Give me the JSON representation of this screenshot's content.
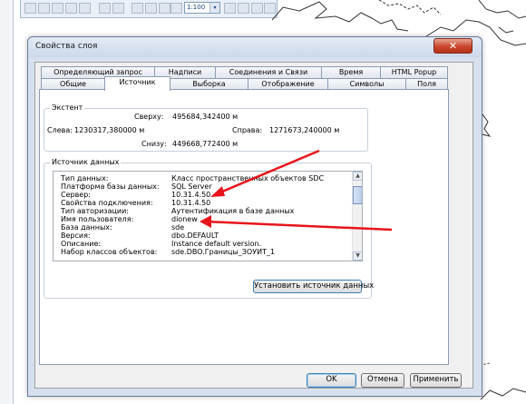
{
  "window": {
    "title": "Свойства слоя",
    "close_glyph": "✕"
  },
  "toolbar": {
    "zoom_value": "1:100",
    "zoom_dropdown_glyph": "▾"
  },
  "tabs": {
    "row1": [
      "Определяющий запрос",
      "Надписи",
      "Соединения и Связи",
      "Время",
      "HTML Popup"
    ],
    "row2": [
      "Общие",
      "Источник",
      "Выборка",
      "Отображение",
      "Символы",
      "Поля"
    ],
    "active": "Источник"
  },
  "extent": {
    "group_label": "Экстент",
    "top_label": "Сверху:",
    "top_value": "495684,342400 м",
    "left_label": "Слева:",
    "left_value": "1230317,380000 м",
    "right_label": "Справа:",
    "right_value": "1271673,240000 м",
    "bottom_label": "Снизу:",
    "bottom_value": "449668,772400 м"
  },
  "source": {
    "group_label": "Источник данных",
    "rows": [
      {
        "key": "Тип данных:",
        "value": "Класс пространственных объектов SDC"
      },
      {
        "key": "Платформа базы данных:",
        "value": "SQL Server"
      },
      {
        "key": "Сервер:",
        "value": "10.31.4.50"
      },
      {
        "key": "Свойства подключения:",
        "value": "10.31.4.50"
      },
      {
        "key": "Тип авторизации:",
        "value": "Аутентификация в базе данных"
      },
      {
        "key": "Имя пользователя:",
        "value": "dionew"
      },
      {
        "key": "База данных:",
        "value": "sde"
      },
      {
        "key": "Версия:",
        "value": "dbo.DEFAULT"
      },
      {
        "key": "Описание:",
        "value": "Instance default version."
      },
      {
        "key": "Набор классов объектов:",
        "value": "sde.DBO.Границы_ЗОУИТ_1"
      }
    ],
    "scroll_up_glyph": "▲",
    "scroll_down_glyph": "▼",
    "set_source_label": "Установить источник данных"
  },
  "buttons": {
    "ok": "OK",
    "cancel": "Отмена",
    "apply": "Применить"
  },
  "colors": {
    "annotation_arrow": "#e8141b",
    "close_button": "#c8462d",
    "dialog_frame": "#d6e0ee"
  }
}
